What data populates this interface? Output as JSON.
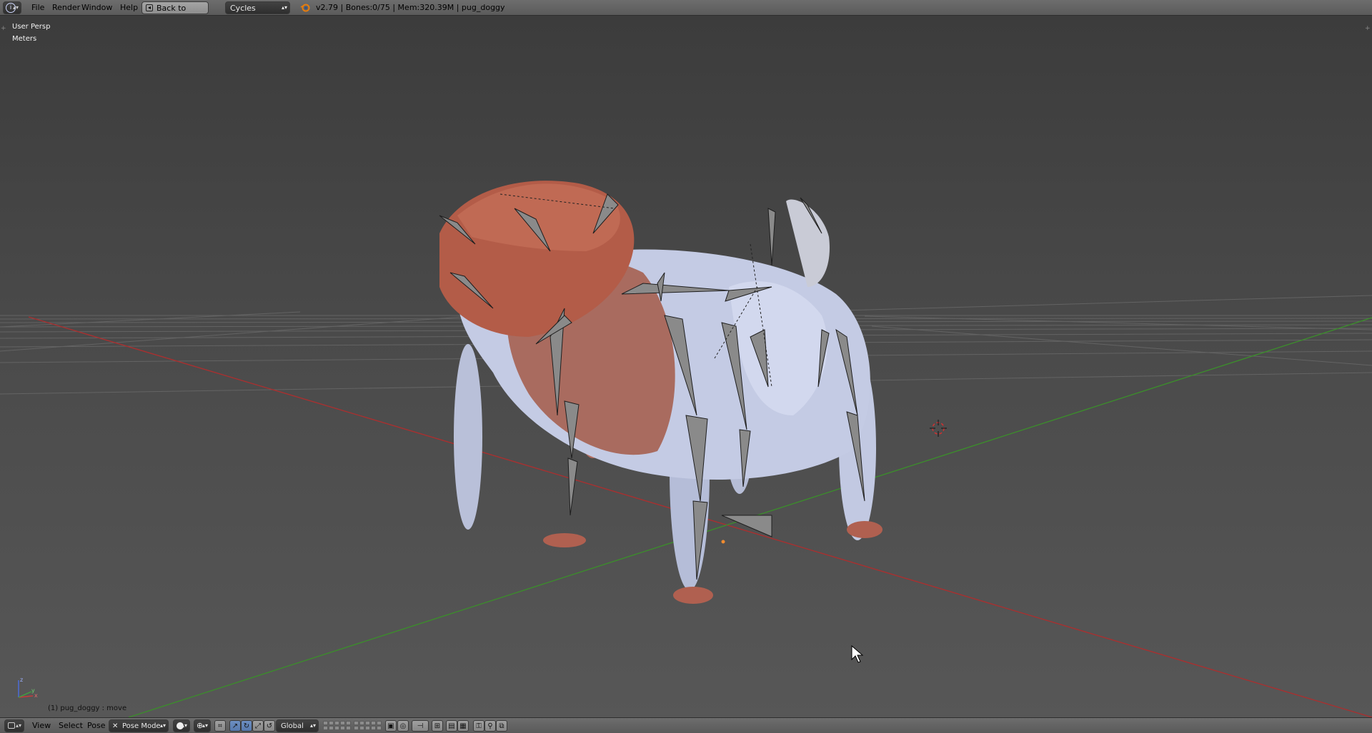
{
  "topbar": {
    "menus": [
      "File",
      "Render",
      "Window",
      "Help"
    ],
    "back_button": "Back to Previous",
    "render_engine": "Cycles Render",
    "stats": "v2.79 | Bones:0/75  | Mem:320.39M | pug_doggy"
  },
  "viewport": {
    "view_name": "User Persp",
    "units": "Meters",
    "status": "(1) pug_doggy : move",
    "axis_labels": {
      "z": "z",
      "x": "x",
      "y": "y"
    }
  },
  "bottombar": {
    "menus": [
      "View",
      "Select",
      "Pose"
    ],
    "mode": "Pose Mode",
    "orientation": "Global"
  },
  "colors": {
    "grid_x_axis": "#a83030",
    "grid_y_axis": "#3c8c2c",
    "fur_red": "#b8553d",
    "fur_light": "#c9d0e8",
    "bone_gray": "#8a8a8a",
    "selected_bone": "#f08c30"
  },
  "icons": [
    "blender-info-icon",
    "back-icon",
    "blender-logo-icon",
    "view3d-editor-icon",
    "pose-mode-icon",
    "shading-solid-icon",
    "pivot-icon",
    "manipulator-icon",
    "translate-icon",
    "rotate-icon",
    "scale-icon",
    "lock-camera-icon",
    "render-icons",
    "mouse-cursor-icon",
    "3d-cursor-icon",
    "axis-gizmo-icon"
  ]
}
